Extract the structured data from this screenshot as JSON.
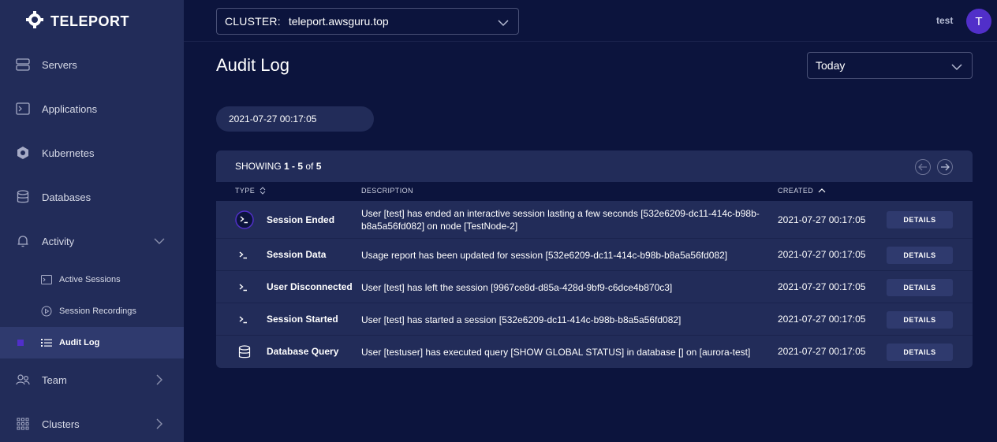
{
  "brand": {
    "name": "TELEPORT"
  },
  "sidebar": {
    "items": [
      {
        "label": "Servers",
        "icon": "server-icon"
      },
      {
        "label": "Applications",
        "icon": "application-icon"
      },
      {
        "label": "Kubernetes",
        "icon": "kubernetes-icon"
      },
      {
        "label": "Databases",
        "icon": "database-icon"
      },
      {
        "label": "Activity",
        "icon": "bell-icon"
      },
      {
        "label": "Active Sessions",
        "icon": "terminal-icon"
      },
      {
        "label": "Session Recordings",
        "icon": "play-icon"
      },
      {
        "label": "Audit Log",
        "icon": "list-icon"
      },
      {
        "label": "Team",
        "icon": "team-icon"
      },
      {
        "label": "Clusters",
        "icon": "grid-icon"
      }
    ]
  },
  "header": {
    "cluster_label": "CLUSTER:",
    "cluster_value": "teleport.awsguru.top",
    "username": "test",
    "avatar_letter": "T"
  },
  "page": {
    "title": "Audit Log",
    "range": "Today",
    "date_pill": "2021-07-27 00:17:05"
  },
  "table": {
    "showing_prefix": "SHOWING ",
    "showing_range": "1 - 5",
    "showing_of": " of ",
    "showing_total": "5",
    "headers": {
      "type": "TYPE",
      "description": "DESCRIPTION",
      "created": "CREATED"
    },
    "rows": [
      {
        "type": "Session Ended",
        "icon": "terminal-icon",
        "description": "User [test] has ended an interactive session lasting a few seconds [532e6209-dc11-414c-b98b-b8a5a56fd082] on node [TestNode-2]",
        "created": "2021-07-27 00:17:05",
        "action": "DETAILS"
      },
      {
        "type": "Session Data",
        "icon": "terminal-icon",
        "description": "Usage report has been updated for session [532e6209-dc11-414c-b98b-b8a5a56fd082]",
        "created": "2021-07-27 00:17:05",
        "action": "DETAILS"
      },
      {
        "type": "User Disconnected",
        "icon": "terminal-icon",
        "description": "User [test] has left the session [9967ce8d-d85a-428d-9bf9-c6dce4b870c3]",
        "created": "2021-07-27 00:17:05",
        "action": "DETAILS"
      },
      {
        "type": "Session Started",
        "icon": "terminal-icon",
        "description": "User [test] has started a session [532e6209-dc11-414c-b98b-b8a5a56fd082]",
        "created": "2021-07-27 00:17:05",
        "action": "DETAILS"
      },
      {
        "type": "Database Query",
        "icon": "database-icon",
        "description": "User [testuser] has executed query [SHOW GLOBAL STATUS] in database [] on [aurora-test]",
        "created": "2021-07-27 00:17:05",
        "action": "DETAILS"
      }
    ]
  },
  "colors": {
    "background": "#0c143d",
    "sidebar": "#222c59",
    "accent": "#512fc9"
  }
}
